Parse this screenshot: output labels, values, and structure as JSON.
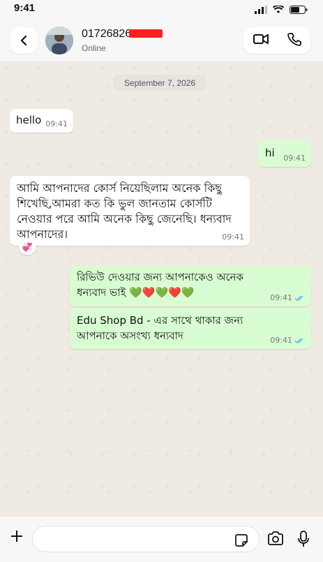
{
  "status_bar": {
    "time": "9:41"
  },
  "header": {
    "contact_name": "01726826",
    "contact_status": "Online"
  },
  "chat": {
    "date_chip": "September 7, 2026",
    "messages": [
      {
        "direction": "incoming",
        "text": "hello",
        "time": "09:41"
      },
      {
        "direction": "outgoing",
        "text": "hi",
        "time": "09:41"
      },
      {
        "direction": "incoming",
        "text": "আমি আপনাদের কোর্স নিয়েছিলাম অনেক কিছু শিখেছি,আমরা কত কি ভুল জানতাম কোর্সটি নেওয়ার পরে আমি অনেক কিছু জেনেছি। ধন্যবাদ আপনাদের।",
        "time": "09:41",
        "reaction": "💞"
      },
      {
        "direction": "outgoing",
        "text": "রিভিউ দেওয়ার জন্য আপনাকেও অনেক ধন্যবাদ ভাই 💚❤️💚❤️💚",
        "time": "09:41"
      },
      {
        "direction": "outgoing",
        "text": "Edu Shop Bd - এর সাথে থাকার জন্য আপনাকে অসংখ্য ধন্যবাদ",
        "time": "09:41"
      }
    ]
  },
  "composer": {
    "value": ""
  },
  "colors": {
    "incoming_bubble": "#ffffff",
    "outgoing_bubble": "#d9fdd3",
    "chat_background": "#efeae2",
    "read_ticks": "#53bdeb",
    "redaction": "#ff1f1f"
  }
}
